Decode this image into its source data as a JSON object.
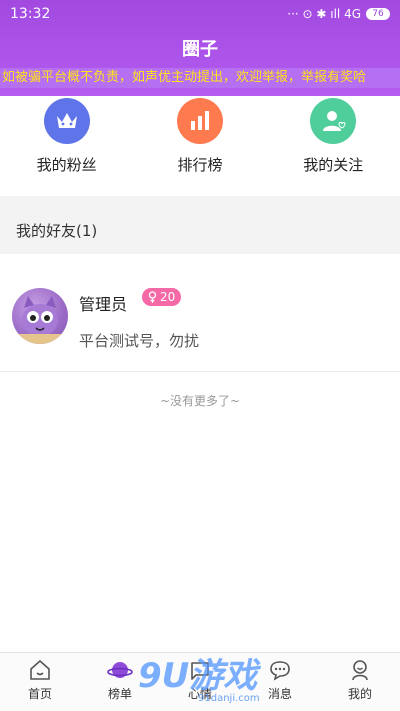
{
  "status_bar": {
    "time": "13:32",
    "indicators": "··· ⊙ ✱ ıll 4G",
    "battery": "76"
  },
  "header": {
    "title": "圈子",
    "notice": "如被骗平台概不负责，如声优主动提出，欢迎举报，举报有奖哈"
  },
  "quick_actions": [
    {
      "label": "我的粉丝",
      "icon": "crown-icon",
      "color": "#5f74e8"
    },
    {
      "label": "排行榜",
      "icon": "bar-chart-icon",
      "color": "#ff7a4f"
    },
    {
      "label": "我的关注",
      "icon": "user-heart-icon",
      "color": "#4fcd9b"
    }
  ],
  "friends_section": {
    "title": "我的好友(1)"
  },
  "friends": [
    {
      "name": "管理员",
      "level": "20",
      "desc": "平台测试号，勿扰"
    }
  ],
  "no_more": "~没有更多了~",
  "tabs": [
    {
      "label": "首页",
      "icon": "home-icon"
    },
    {
      "label": "榜单",
      "icon": "planet-icon"
    },
    {
      "label": "心情",
      "icon": "mood-icon"
    },
    {
      "label": "消息",
      "icon": "chat-icon"
    },
    {
      "label": "我的",
      "icon": "profile-icon"
    }
  ],
  "watermark": {
    "main": "9U游戏",
    "sub": "91danji.com"
  }
}
